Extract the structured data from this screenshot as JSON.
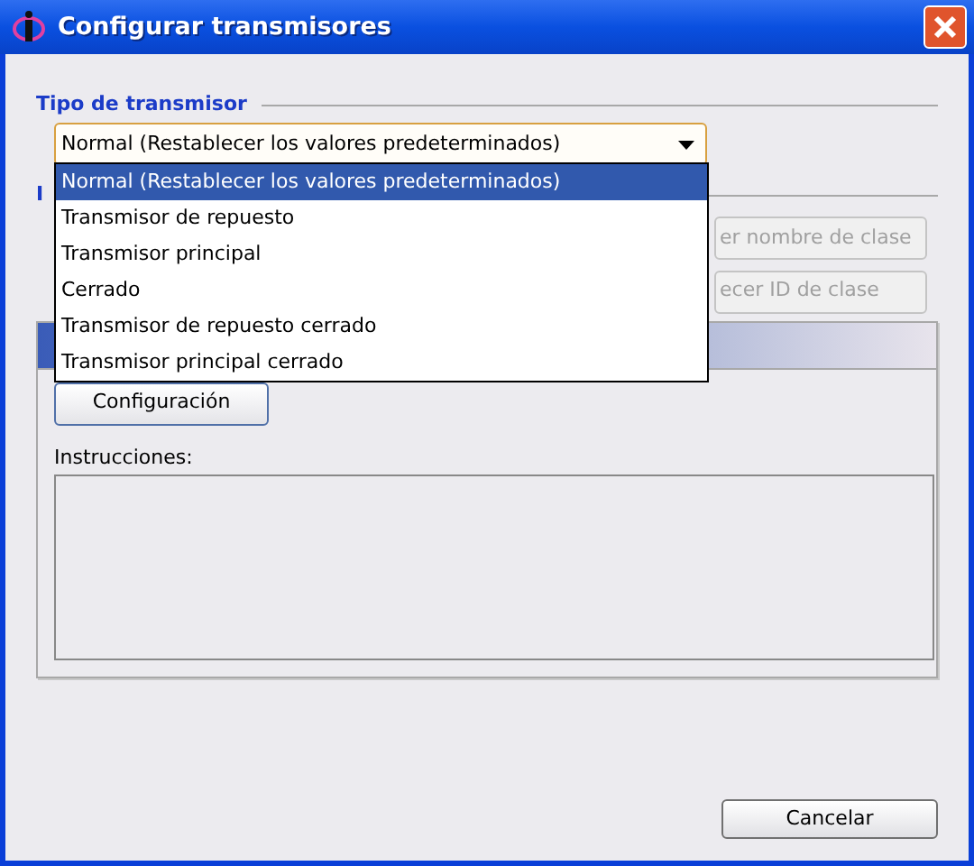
{
  "window": {
    "title": "Configurar transmisores"
  },
  "transmitter_type": {
    "label": "Tipo de transmisor",
    "value": "Normal (Restablecer los valores predeterminados)",
    "expanded": true,
    "options": [
      {
        "label": "Normal (Restablecer los valores predeterminados)",
        "selected": true
      },
      {
        "label": "Transmisor de repuesto",
        "selected": false
      },
      {
        "label": "Transmisor principal",
        "selected": false
      },
      {
        "label": "Cerrado",
        "selected": false
      },
      {
        "label": "Transmisor de repuesto cerrado",
        "selected": false
      },
      {
        "label": "Transmisor principal cerrado",
        "selected": false
      }
    ]
  },
  "second_group": {
    "label": "I"
  },
  "side_buttons": [
    {
      "label": "er nombre de clase",
      "disabled": true
    },
    {
      "label": "ecer ID de clase",
      "disabled": true
    }
  ],
  "panel": {
    "config_button": "Configuración",
    "instructions_label": "Instrucciones:"
  },
  "buttons": [
    "Cancelar"
  ]
}
